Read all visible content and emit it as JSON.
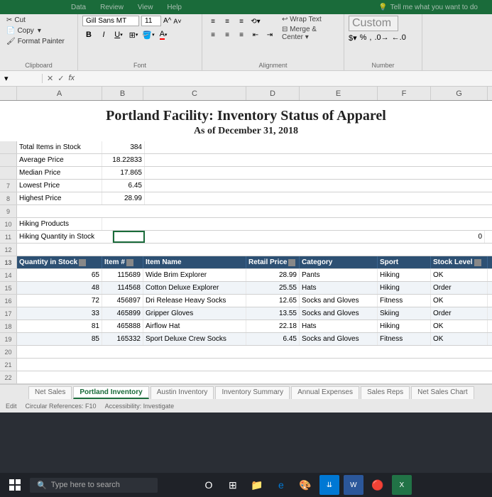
{
  "ribbonTabs": [
    "Data",
    "Review",
    "View",
    "Help"
  ],
  "tellMe": "Tell me what you want to do",
  "clipboard": {
    "cut": "Cut",
    "copy": "Copy",
    "formatPainter": "Format Painter",
    "label": "Clipboard"
  },
  "font": {
    "name": "Gill Sans MT",
    "size": "11",
    "label": "Font"
  },
  "alignment": {
    "wrap": "Wrap Text",
    "merge": "Merge & Center",
    "label": "Alignment"
  },
  "number": {
    "format": "Custom",
    "label": "Number"
  },
  "formulaBar": {
    "fx": "fx"
  },
  "columns": [
    "A",
    "B",
    "C",
    "D",
    "E",
    "F",
    "G"
  ],
  "title": "Portland Facility: Inventory Status of Apparel",
  "subtitle": "As of December 31, 2018",
  "summary": [
    {
      "row": "",
      "label": "Total Items in Stock",
      "value": "384"
    },
    {
      "row": "",
      "label": "Average Price",
      "value": "18.22833"
    },
    {
      "row": "",
      "label": "Median Price",
      "value": "17.865"
    },
    {
      "row": "7",
      "label": "Lowest Price",
      "value": "6.45"
    },
    {
      "row": "8",
      "label": "Highest Price",
      "value": "28.99"
    }
  ],
  "row9": "9",
  "row10": {
    "num": "10",
    "label": "Hiking Products"
  },
  "row11": {
    "num": "11",
    "label": "Hiking Quantity in Stock",
    "farValue": "0"
  },
  "row12": "12",
  "tableHeader": {
    "row": "13",
    "cols": [
      "Quantity in Stock",
      "Item #",
      "Item Name",
      "Retail Price",
      "Category",
      "Sport",
      "Stock Level"
    ]
  },
  "tableData": [
    {
      "row": "14",
      "qty": "65",
      "item": "115689",
      "name": "Wide Brim Explorer",
      "price": "28.99",
      "cat": "Pants",
      "sport": "Hiking",
      "stock": "OK"
    },
    {
      "row": "15",
      "qty": "48",
      "item": "114568",
      "name": "Cotton Deluxe Explorer",
      "price": "25.55",
      "cat": "Hats",
      "sport": "Hiking",
      "stock": "Order"
    },
    {
      "row": "16",
      "qty": "72",
      "item": "456897",
      "name": "Dri Release Heavy Socks",
      "price": "12.65",
      "cat": "Socks and Gloves",
      "sport": "Fitness",
      "stock": "OK"
    },
    {
      "row": "17",
      "qty": "33",
      "item": "465899",
      "name": "Gripper Gloves",
      "price": "13.55",
      "cat": "Socks and Gloves",
      "sport": "Skiing",
      "stock": "Order"
    },
    {
      "row": "18",
      "qty": "81",
      "item": "465888",
      "name": "Airflow Hat",
      "price": "22.18",
      "cat": "Hats",
      "sport": "Hiking",
      "stock": "OK"
    },
    {
      "row": "19",
      "qty": "85",
      "item": "165332",
      "name": "Sport Deluxe Crew Socks",
      "price": "6.45",
      "cat": "Socks and Gloves",
      "sport": "Fitness",
      "stock": "OK"
    }
  ],
  "emptyRows": [
    "20",
    "21",
    "22"
  ],
  "sheetTabs": [
    "Net Sales",
    "Portland Inventory",
    "Austin Inventory",
    "Inventory Summary",
    "Annual Expenses",
    "Sales Reps",
    "Net Sales Chart"
  ],
  "activeTab": 1,
  "statusBar": {
    "edit": "Edit",
    "circular": "Circular References: F10",
    "accessibility": "Accessibility: Investigate"
  },
  "taskbar": {
    "search": "Type here to search"
  }
}
